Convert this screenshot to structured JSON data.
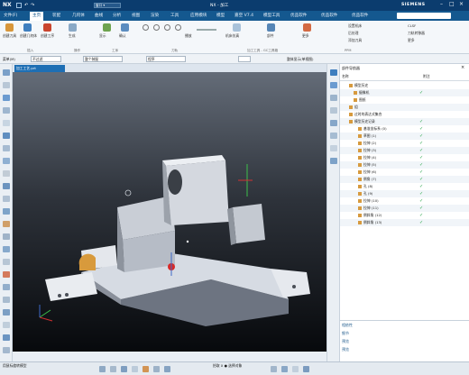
{
  "title_bar": {
    "app_name": "NX",
    "document": "NX - 加工",
    "brand": "SIEMENS"
  },
  "menu": {
    "items": [
      "文件(F)",
      "主页",
      "装配",
      "几何体",
      "曲线",
      "分析",
      "视图",
      "渲染",
      "工具",
      "应用模块",
      "模型",
      "嘉空 V7.4",
      "模型工具",
      "优品软件",
      "优品软件",
      "优品软件"
    ],
    "active": "主页"
  },
  "ribbon": {
    "group1": {
      "title": "插入",
      "buttons": [
        "创建刀具",
        "创建几何体",
        "创建工序"
      ]
    },
    "group2": {
      "title": "操作",
      "buttons": [
        "生成"
      ]
    },
    "group3": {
      "title": "工序",
      "buttons": [
        "显示",
        "确认"
      ]
    },
    "group4": {
      "title": "刀轨",
      "buttons": [
        "播放"
      ]
    },
    "group5": {
      "title": "加工工具 - GC工具箱",
      "buttons": [
        "机床仿真",
        "部件",
        "更多"
      ]
    },
    "group6": {
      "title": "PPM",
      "buttons": [
        "设置机床",
        "CLSF",
        "后处理",
        "刀轨转移器",
        "添加刀具",
        "更多"
      ]
    }
  },
  "toolbar2": {
    "filter": "菜单(M)",
    "dropdown1": "不过滤",
    "dropdown2": "整个装配",
    "dropdown3": "程序",
    "label": "整体显示(单视图)"
  },
  "document_tab": "加工工艺.prt",
  "nav_panel": {
    "title": "部件导航器",
    "col_name": "名称",
    "col_attr": "附注",
    "rows": [
      {
        "text": "模型历史",
        "indent": 2,
        "check": false
      },
      {
        "text": "摄像机",
        "indent": 3,
        "check": true
      },
      {
        "text": "图纸",
        "indent": 3,
        "check": false
      },
      {
        "text": "组",
        "indent": 2,
        "check": false
      },
      {
        "text": "过时的表达式集合",
        "indent": 2,
        "check": false
      },
      {
        "text": "模型历史记录",
        "indent": 2,
        "check": true
      },
      {
        "text": "基准坐标系 (0)",
        "indent": 4,
        "check": true
      },
      {
        "text": "草图 (1)",
        "indent": 4,
        "check": true
      },
      {
        "text": "拉伸 (2)",
        "indent": 4,
        "check": true
      },
      {
        "text": "拉伸 (3)",
        "indent": 4,
        "check": true
      },
      {
        "text": "拉伸 (4)",
        "indent": 4,
        "check": true
      },
      {
        "text": "拉伸 (5)",
        "indent": 4,
        "check": true
      },
      {
        "text": "拉伸 (6)",
        "indent": 4,
        "check": true
      },
      {
        "text": "倒角 (7)",
        "indent": 4,
        "check": true
      },
      {
        "text": "孔 (8)",
        "indent": 4,
        "check": true
      },
      {
        "text": "孔 (9)",
        "indent": 4,
        "check": true
      },
      {
        "text": "拉伸 (10)",
        "indent": 4,
        "check": true
      },
      {
        "text": "拉伸 (11)",
        "indent": 4,
        "check": true
      },
      {
        "text": "倒斜角 (12)",
        "indent": 4,
        "check": true
      },
      {
        "text": "倒斜角 (13)",
        "indent": 4,
        "check": true
      }
    ],
    "sections": [
      "相依性",
      "细节",
      "预览",
      "预览"
    ]
  },
  "status": {
    "left": "用鼠标旋转模型",
    "center": "拾取 X ● 选择对象"
  },
  "colors": {
    "title": "#0b3c6e",
    "menu": "#14588f",
    "accent": "#1e6fb4"
  }
}
